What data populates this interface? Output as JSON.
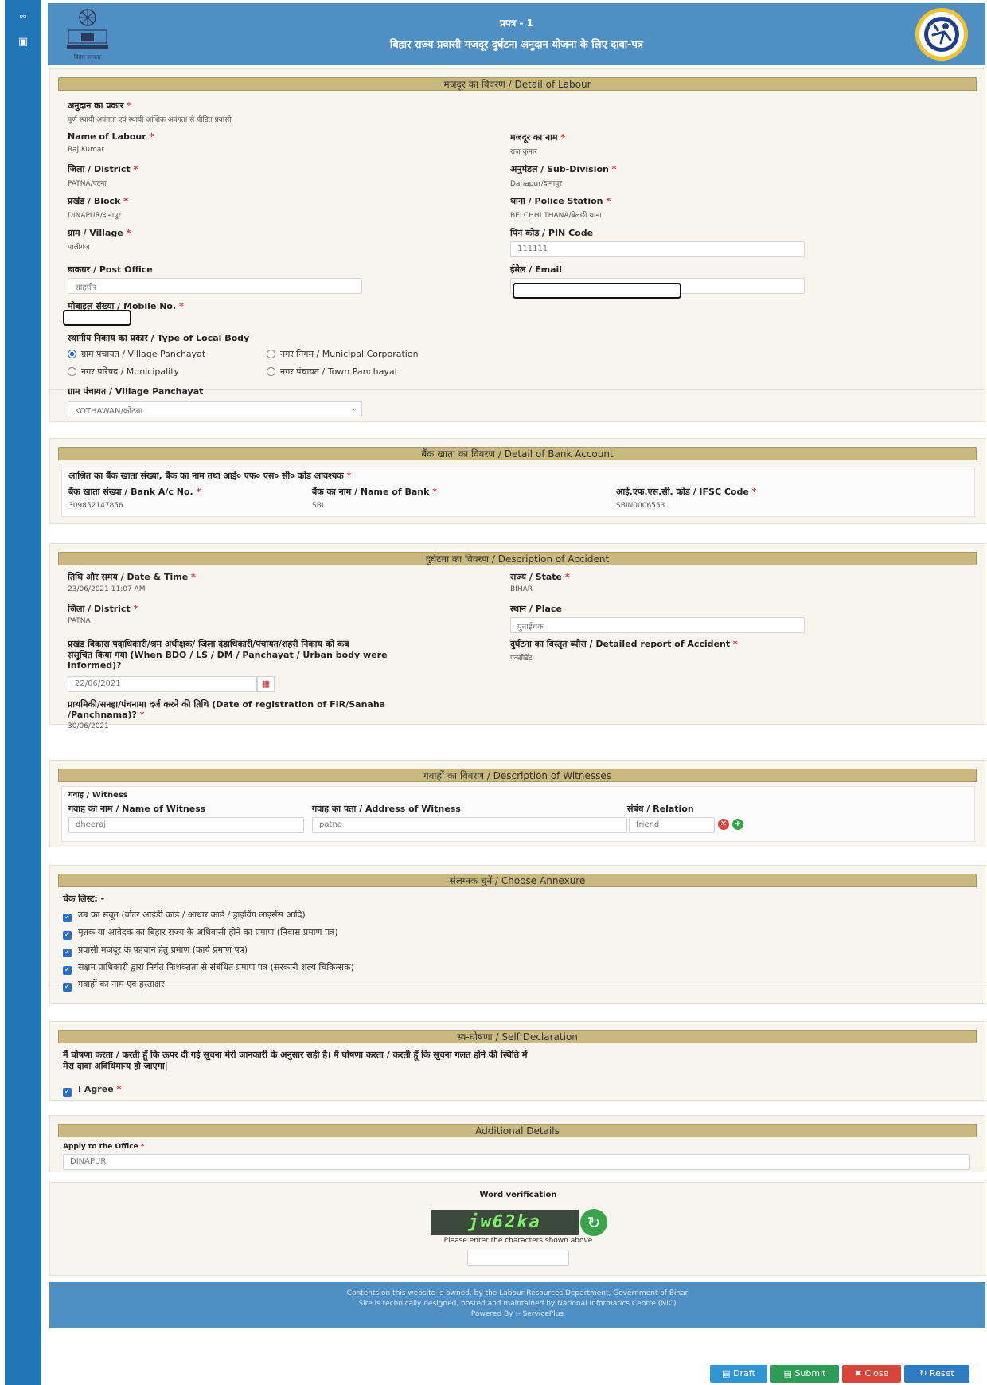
{
  "rail": {
    "share_icon": "share-icon",
    "menu_icon": "menu-icon"
  },
  "header": {
    "line1": "प्रपत्र - 1",
    "line2": "बिहार राज्य प्रवासी मजदूर दुर्घटना अनुदान योजना के लिए दावा-पत्र",
    "left_logo_text": "बिहार सरकार"
  },
  "labour": {
    "title": "मजदूर का विवरण / Detail of Labour",
    "grant_type_label": "अनुदान का प्रकार",
    "grant_type_value": "पूर्ण स्थायी अपंगता एवं स्थायी आंशिक अपंगता से पीड़ित प्रवासी",
    "name_label": "Name of Labour",
    "name_value": "Raj Kumar",
    "name_hi_label": "मजदूर का नाम",
    "name_hi_value": "राज कुमार",
    "district_label": "जिला / District",
    "district_value": "PATNA/पटना",
    "subdivision_label": "अनुमंडल / Sub-Division",
    "subdivision_value": "Danapur/दानापुर",
    "block_label": "प्रखंड / Block",
    "block_value": "DINAPUR/दानापुर",
    "police_label": "थाना / Police Station",
    "police_value": "BELCHHI THANA/बेलछी थाना",
    "village_label": "ग्राम / Village",
    "village_value": "पालीगंज",
    "pin_label": "पिन कोड / PIN Code",
    "pin_value": "111111",
    "post_label": "डाकघर / Post Office",
    "post_value": "शाहपीर",
    "email_label": "ईमेल / Email",
    "mobile_label": "मोबाइल संख्या / Mobile No.",
    "localbody_label": "स्थानीय निकाय का प्रकार / Type of Local Body",
    "opt_village": "ग्राम पंचायत / Village Panchayat",
    "opt_municipal_corp": "नगर निगम / Municipal Corporation",
    "opt_municipality": "नगर परिषद / Municipality",
    "opt_town": "नगर पंचायत / Town Panchayat",
    "panchayat_label": "ग्राम पंचायत / Village Panchayat",
    "panchayat_value": "KOTHAWAN/कोठवा"
  },
  "bank": {
    "title": "बैंक खाता का विवरण / Detail of Bank Account",
    "note": "आश्रित का बैंक खाता संख्या, बैंक का नाम तथा आई० एफ० एस० सी० कोड आवश्यक",
    "acno_label": "बैंक खाता संख्या / Bank A/c No.",
    "acno_value": "309852147856",
    "bank_label": "बैंक का नाम / Name of Bank",
    "bank_value": "SBI",
    "ifsc_label": "आई.एफ.एस.सी. कोड / IFSC Code",
    "ifsc_value": "SBIN0006553"
  },
  "accident": {
    "title": "दुर्घटना का विवरण / Description of Accident",
    "datetime_label": "तिथि और समय / Date & Time",
    "datetime_value": "23/06/2021 11:07 AM",
    "state_label": "राज्य / State",
    "state_value": "BIHAR",
    "district_label": "जिला / District",
    "district_value": "PATNA",
    "place_label": "स्थान / Place",
    "place_value": "पुनाईचक",
    "informed_label_1": "प्रखंड विकास पदाधिकारी/श्रम अधीक्षक/ जिला दंडाधिकारी/पंचायत/शहरी निकाय को कब",
    "informed_label_2": "संसूचित किया गया (When BDO / LS / DM / Panchayat / Urban body were",
    "informed_label_3": "informed)?",
    "informed_value": "22/06/2021",
    "report_label": "दुर्घटना का विस्तृत ब्यौरा / Detailed report of Accident",
    "report_value": "एक्सीडेंट",
    "fir_label_1": "प्राथमिकी/सनहा/पंचनामा दर्ज करने की तिथि (Date of registration of FIR/Sanaha",
    "fir_label_2": "/Panchnama)?",
    "fir_value": "30/06/2021"
  },
  "witness": {
    "title": "गवाहों का विवरण / Description of Witnesses",
    "sub": "गवाह / Witness",
    "name_label": "गवाह का नाम / Name of Witness",
    "address_label": "गवाह का पता / Address of Witness",
    "relation_label": "संबंध / Relation",
    "name_value": "dheeraj",
    "address_value": "patna",
    "relation_value": "friend"
  },
  "annexure": {
    "title": "संलग्नक चुनें / Choose Annexure",
    "checklist_label": "चेक लिस्ट: -",
    "items": [
      "उम्र का सबूत (वोटर आईडी कार्ड / आधार कार्ड / ड्राइविंग लाइसेंस आदि)",
      "मृतक या आवेदक का बिहार राज्य के अधिवासी होने का प्रमाण (निवास प्रमाण पत्र)",
      "प्रवासी मजदूर के पहचान हेतु प्रमाण (कार्य प्रमाण पत्र)",
      "सक्षम प्राधिकारी द्वारा निर्गत निःशक्तता से संबंधित प्रमाण पत्र (सरकारी शल्य चिकित्सक)",
      "गवाहों का नाम एवं हस्ताक्षर"
    ]
  },
  "declaration": {
    "title": "स्व-घोषणा / Self Declaration",
    "text_1": "मैं घोषणा करता / करती हूँ कि ऊपर दी गई सूचना मेरी जानकारी के अनुसार सही है। मैं घोषणा करता / करती हूँ कि सूचना गलत होने की स्थिति में",
    "text_2": "मेरा दावा अविधिमान्य हो जाएगा|",
    "agree_label": "I Agree"
  },
  "additional": {
    "title": "Additional Details",
    "office_label": "Apply to the Office",
    "office_value": "DINAPUR"
  },
  "verification": {
    "title": "Word verification",
    "captcha_text": "jw62ka",
    "hint": "Please enter the characters shown above"
  },
  "footer": {
    "line1": "Contents on this website is owned, by the Labour Resources Department, Government of Bihar",
    "line2": "Site is technically designed, hosted and maintained by National Informatics Centre (NIC)",
    "line3": "Powered By :- ServicePlus"
  },
  "buttons": {
    "draft": "Draft",
    "submit": "Submit",
    "close": "Close",
    "reset": "Reset"
  },
  "colors": {
    "header": "#4f8fc4",
    "panel_head": "#c9b97f",
    "draft": "#2f96d2",
    "submit": "#2e9b56",
    "close": "#d9443a",
    "reset": "#2f7ac0"
  }
}
